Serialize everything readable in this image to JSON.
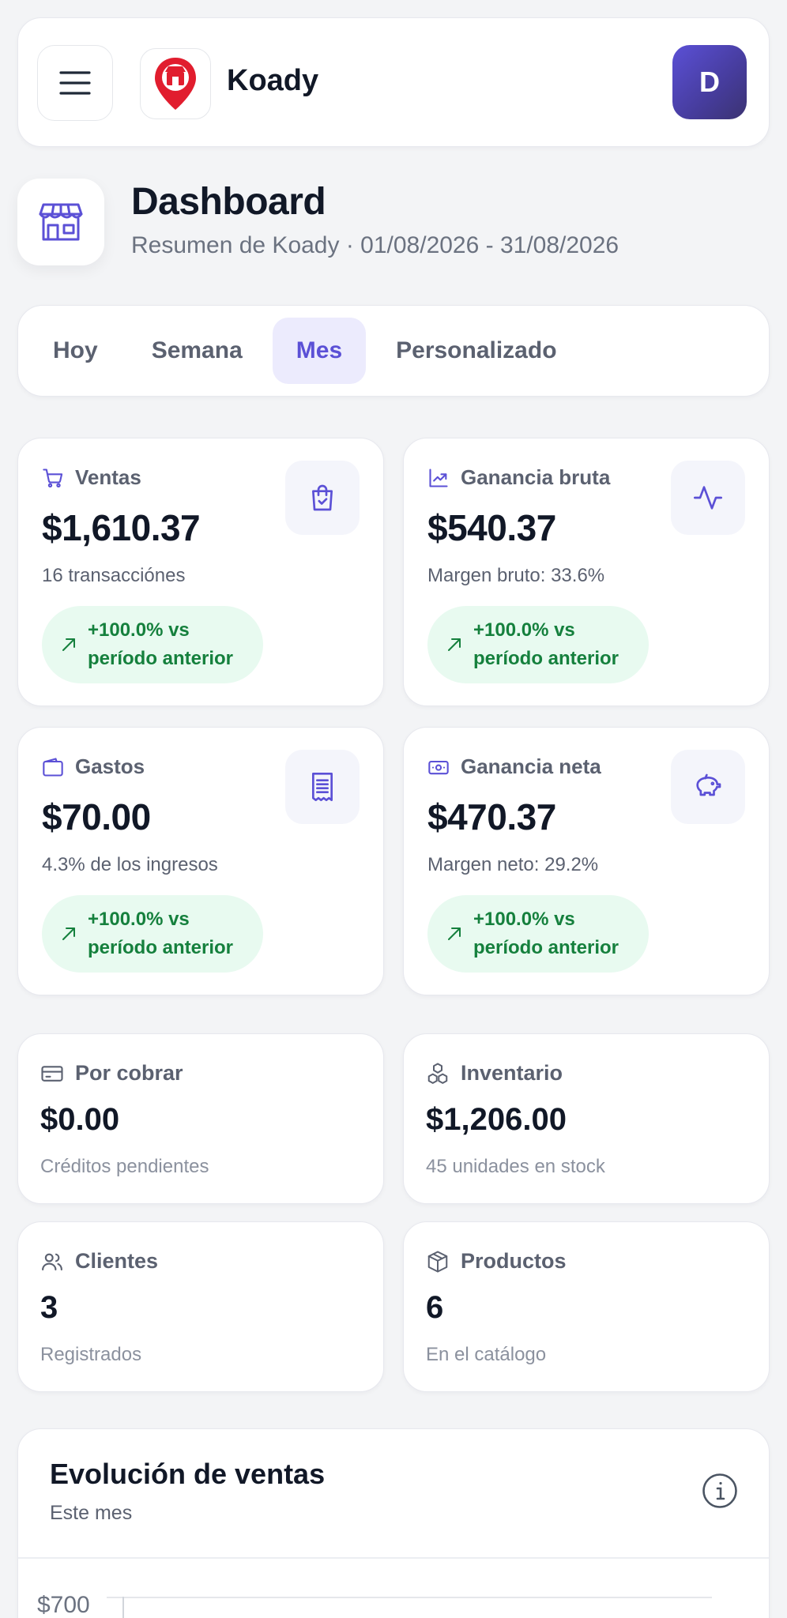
{
  "header": {
    "brand": "Koady",
    "avatar_initial": "D"
  },
  "page": {
    "title": "Dashboard",
    "subtitle": "Resumen de Koady · 01/08/2026 - 31/08/2026"
  },
  "tabs": [
    {
      "label": "Hoy",
      "active": false
    },
    {
      "label": "Semana",
      "active": false
    },
    {
      "label": "Mes",
      "active": true
    },
    {
      "label": "Personalizado",
      "active": false
    }
  ],
  "metrics": [
    {
      "label": "Ventas",
      "icon": "cart-icon",
      "tile_icon": "shopping-bag-icon",
      "value": "$1,610.37",
      "sub": "16 transacciónes",
      "badge": "+100.0% vs\nperíodo anterior"
    },
    {
      "label": "Ganancia bruta",
      "icon": "trending-up-icon",
      "tile_icon": "activity-icon",
      "value": "$540.37",
      "sub": "Margen bruto: 33.6%",
      "badge": "+100.0% vs\nperíodo anterior"
    },
    {
      "label": "Gastos",
      "icon": "wallet-icon",
      "tile_icon": "receipt-icon",
      "value": "$70.00",
      "sub": "4.3% de los ingresos",
      "badge": "+100.0% vs\nperíodo anterior"
    },
    {
      "label": "Ganancia neta",
      "icon": "banknote-icon",
      "tile_icon": "piggy-bank-icon",
      "value": "$470.37",
      "sub": "Margen neto: 29.2%",
      "badge": "+100.0% vs\nperíodo anterior"
    }
  ],
  "stats": [
    {
      "label": "Por cobrar",
      "icon": "credit-card-icon",
      "value": "$0.00",
      "sub": "Créditos pendientes"
    },
    {
      "label": "Inventario",
      "icon": "boxes-icon",
      "value": "$1,206.00",
      "sub": "45 unidades en stock"
    },
    {
      "label": "Clientes",
      "icon": "users-icon",
      "value": "3",
      "sub": "Registrados"
    },
    {
      "label": "Productos",
      "icon": "package-icon",
      "value": "6",
      "sub": "En el catálogo"
    }
  ],
  "chart": {
    "title": "Evolución de ventas",
    "subtitle": "Este mes",
    "y_tick": "$700"
  },
  "colors": {
    "accent": "#5b50d6",
    "positive": "#15803d",
    "positive_bg": "#e8faf0"
  }
}
